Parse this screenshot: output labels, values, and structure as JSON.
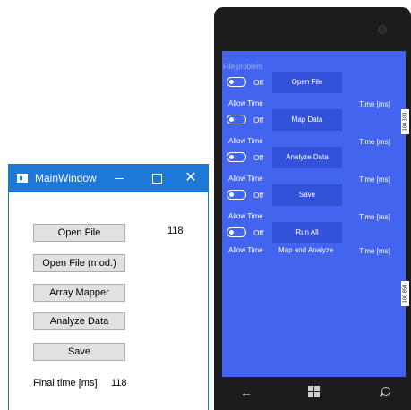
{
  "window": {
    "title": "MainWindow",
    "buttons": {
      "open_file": "Open File",
      "open_file_mod": "Open File (mod.)",
      "array_mapper": "Array Mapper",
      "analyze_data": "Analyze Data",
      "save": "Save"
    },
    "open_file_value": "118",
    "final_time_label": "Final time [ms]",
    "final_time_value": "118"
  },
  "phone": {
    "header": "File problem",
    "rows": [
      {
        "toggle_state": "Off",
        "button": "Open File",
        "allow_time": "Allow Time",
        "middle": "",
        "time_label": "Time [ms]"
      },
      {
        "toggle_state": "Off",
        "button": "Map Data",
        "allow_time": "Allow Time",
        "middle": "",
        "time_label": "Time [ms]"
      },
      {
        "toggle_state": "Off",
        "button": "Analyze Data",
        "allow_time": "Allow Time",
        "middle": "",
        "time_label": "Time [ms]"
      },
      {
        "toggle_state": "Off",
        "button": "Save",
        "allow_time": "Allow Time",
        "middle": "",
        "time_label": "Time [ms]"
      },
      {
        "toggle_state": "Off",
        "button": "Run All",
        "allow_time": "Allow Time",
        "middle": "Map and Analyze",
        "time_label": "Time [ms]"
      }
    ],
    "side_badges": [
      "100 100",
      "100 850"
    ],
    "colors": {
      "screen_bg": "#4364ee",
      "button_bg": "#3452d9",
      "window_accent": "#1e78d7"
    },
    "icons": {
      "nav_back": "back-arrow-icon",
      "nav_home": "windows-logo-icon",
      "nav_search": "search-icon"
    }
  }
}
